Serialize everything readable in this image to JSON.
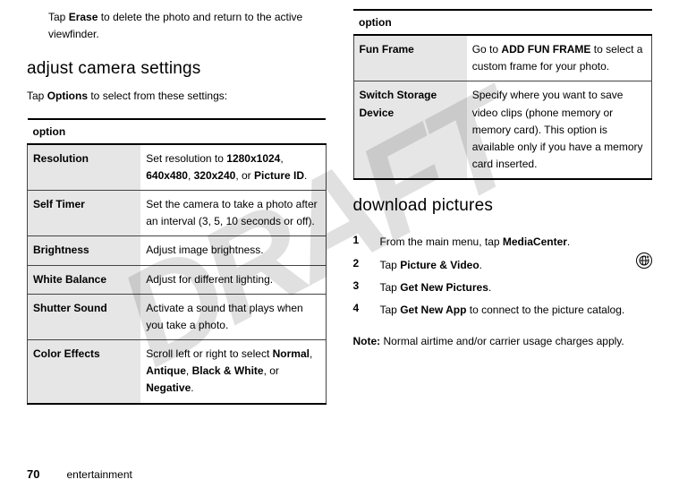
{
  "left": {
    "intro_prefix": "Tap ",
    "erase": "Erase",
    "intro_suffix": " to delete the photo and return to the active viewfinder.",
    "heading": "adjust camera settings",
    "tap_options_pre": "Tap ",
    "options": "Options",
    "tap_options_post": " to select from these settings:",
    "option_header": "option",
    "rows": [
      {
        "label": "Resolution",
        "pre": "Set resolution to ",
        "opts": [
          "1280x1024",
          "640x480",
          "320x240",
          "Picture ID"
        ],
        "joins": [
          ", ",
          ", ",
          ", or "
        ],
        "post": "."
      },
      {
        "label": "Self Timer",
        "text": "Set the camera to take a photo after an interval (3, 5, 10 seconds or off)."
      },
      {
        "label": "Brightness",
        "text": "Adjust image brightness."
      },
      {
        "label": "White Balance",
        "text": "Adjust for different lighting."
      },
      {
        "label": "Shutter Sound",
        "text": "Activate a sound that plays when you take a photo."
      },
      {
        "label": "Color Effects",
        "pre": "Scroll left or right to select ",
        "opts": [
          "Normal",
          "Antique",
          "Black & White",
          "Negative"
        ],
        "joins": [
          ", ",
          ", ",
          ", or "
        ],
        "post": "."
      }
    ]
  },
  "right": {
    "option_header": "option",
    "rows": [
      {
        "label": "Fun Frame",
        "pre": "Go to ",
        "opts": [
          "ADD FUN FRAME"
        ],
        "joins": [],
        "post": " to select a custom frame for your photo."
      },
      {
        "label": "Switch Storage Device",
        "text": "Specify where you want to save video clips (phone memory or memory card). This option is available only if you have a memory card inserted."
      }
    ],
    "heading": "download pictures",
    "steps": [
      {
        "num": "1",
        "pre": "From the main menu, tap ",
        "bold": " MediaCenter",
        "post": "."
      },
      {
        "num": "2",
        "pre": "Tap ",
        "bold": "Picture & Video",
        "post": "."
      },
      {
        "num": "3",
        "pre": "Tap ",
        "bold": "Get New Pictures",
        "post": "."
      },
      {
        "num": "4",
        "pre": "Tap ",
        "bold": "Get New App",
        "post": " to connect to the picture catalog."
      }
    ],
    "note_label": "Note:",
    "note_text": " Normal airtime and/or carrier usage charges apply."
  },
  "watermark": "DRAFT",
  "page_number": "70",
  "section_name": "entertainment"
}
